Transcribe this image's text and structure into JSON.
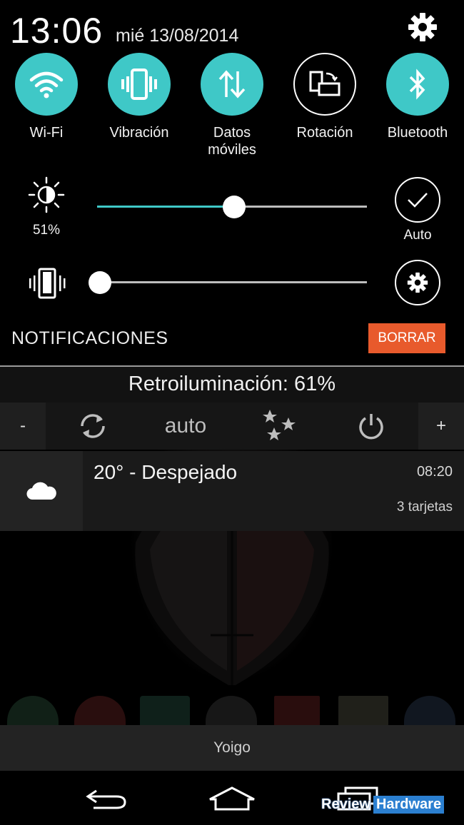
{
  "status": {
    "time": "13:06",
    "date": "mié 13/08/2014"
  },
  "quick_toggles": [
    {
      "label": "Wi-Fi",
      "icon": "wifi-icon",
      "active": true
    },
    {
      "label": "Vibración",
      "icon": "vibrate-icon",
      "active": true
    },
    {
      "label": "Datos\nmóviles",
      "icon": "data-arrows-icon",
      "active": true
    },
    {
      "label": "Rotación",
      "icon": "rotation-icon",
      "active": false
    },
    {
      "label": "Bluetooth",
      "icon": "bluetooth-icon",
      "active": true
    }
  ],
  "brightness": {
    "percent_label": "51%",
    "level": 0.51,
    "auto_label": "Auto"
  },
  "volume": {
    "level": 0.0
  },
  "notifications": {
    "title": "NOTIFICACIONES",
    "clear_label": "BORRAR"
  },
  "backlight": {
    "text": "Retroiluminación: 61%",
    "minus": "-",
    "plus": "+",
    "mode": "auto"
  },
  "weather_card": {
    "title": "20° - Despejado",
    "time": "08:20",
    "subtitle": "3 tarjetas",
    "icon": "cloud-icon"
  },
  "carrier": "Yoigo",
  "watermark": {
    "part1": "Review",
    "part2": "Hardware"
  },
  "colors": {
    "accent": "#3fc8c7",
    "clear_button": "#e85a2c",
    "watermark_blue": "#2b7fd0"
  }
}
